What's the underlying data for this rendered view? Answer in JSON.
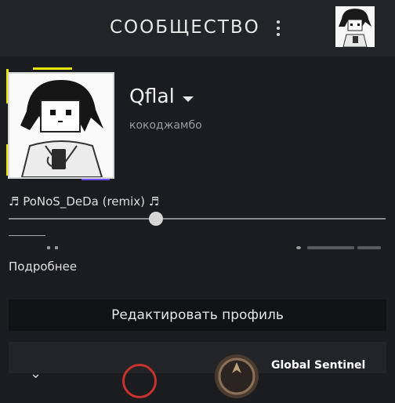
{
  "header": {
    "title": "СООБЩЕСТВО"
  },
  "profile": {
    "name": "Qflal",
    "real_name": "кокоджамбо"
  },
  "now_playing": {
    "track": "♬ PoNoS_DeDa (remix) ♬",
    "progress": 0.39
  },
  "links": {
    "more": "Подробнее"
  },
  "actions": {
    "edit_profile": "Редактировать профиль"
  },
  "badge": {
    "rank_title": "Global Sentinel"
  },
  "colors": {
    "level_ring": "#c8322d"
  }
}
